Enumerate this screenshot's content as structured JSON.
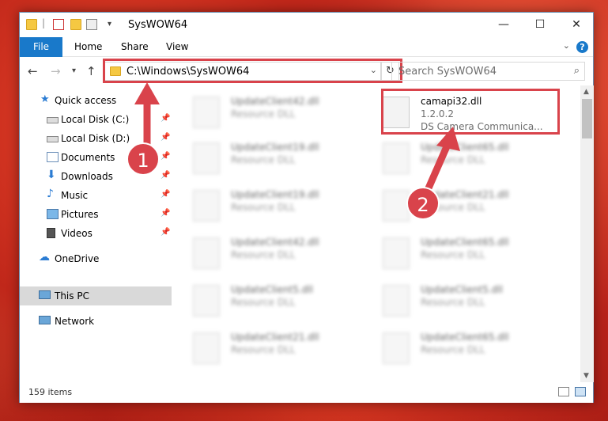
{
  "window": {
    "title": "SysWOW64",
    "controls": {
      "minimize": "—",
      "maximize": "☐",
      "close": "✕"
    }
  },
  "ribbon": {
    "file": "File",
    "home": "Home",
    "share": "Share",
    "view": "View",
    "help": "?"
  },
  "address": {
    "path": "C:\\Windows\\SysWOW64",
    "search_placeholder": "Search SysWOW64"
  },
  "sidebar": {
    "items": [
      {
        "label": "Quick access",
        "icon": "star-icon"
      },
      {
        "label": "Local Disk (C:)",
        "icon": "drive-icon",
        "pinned": true
      },
      {
        "label": "Local Disk (D:)",
        "icon": "drive-icon",
        "pinned": true
      },
      {
        "label": "Documents",
        "icon": "documents-icon",
        "pinned": true
      },
      {
        "label": "Downloads",
        "icon": "download-icon",
        "pinned": true
      },
      {
        "label": "Music",
        "icon": "music-icon",
        "pinned": true
      },
      {
        "label": "Pictures",
        "icon": "pictures-icon",
        "pinned": true
      },
      {
        "label": "Videos",
        "icon": "videos-icon",
        "pinned": true
      },
      {
        "label": "OneDrive",
        "icon": "cloud-icon"
      },
      {
        "label": "This PC",
        "icon": "computer-icon",
        "selected": true
      },
      {
        "label": "Network",
        "icon": "network-icon"
      }
    ]
  },
  "files": {
    "main": {
      "name": "camapi32.dll",
      "version": "1.2.0.2",
      "description": "DS Camera Communica..."
    },
    "blurred": [
      {
        "name": "UpdateClient42.dll",
        "type": "Resource DLL"
      },
      {
        "name": "UpdateClient19.dll",
        "type": "Resource DLL"
      },
      {
        "name": "UpdateClient65.dll",
        "type": "Resource DLL"
      },
      {
        "name": "UpdateClient19.dll",
        "type": "Resource DLL"
      },
      {
        "name": "UpdateClient21.dll",
        "type": "Resource DLL"
      },
      {
        "name": "UpdateClient42.dll",
        "type": "Resource DLL"
      },
      {
        "name": "UpdateClient65.dll",
        "type": "Resource DLL"
      },
      {
        "name": "UpdateClient5.dll",
        "type": "Resource DLL"
      },
      {
        "name": "UpdateClient5.dll",
        "type": "Resource DLL"
      },
      {
        "name": "UpdateClient21.dll",
        "type": "Resource DLL"
      },
      {
        "name": "UpdateClient65.dll",
        "type": "Resource DLL"
      }
    ]
  },
  "status": {
    "item_count": "159 items"
  },
  "annotations": {
    "badge1": "1",
    "badge2": "2"
  },
  "colors": {
    "accent": "#1979ca",
    "highlight": "#d9434b"
  }
}
